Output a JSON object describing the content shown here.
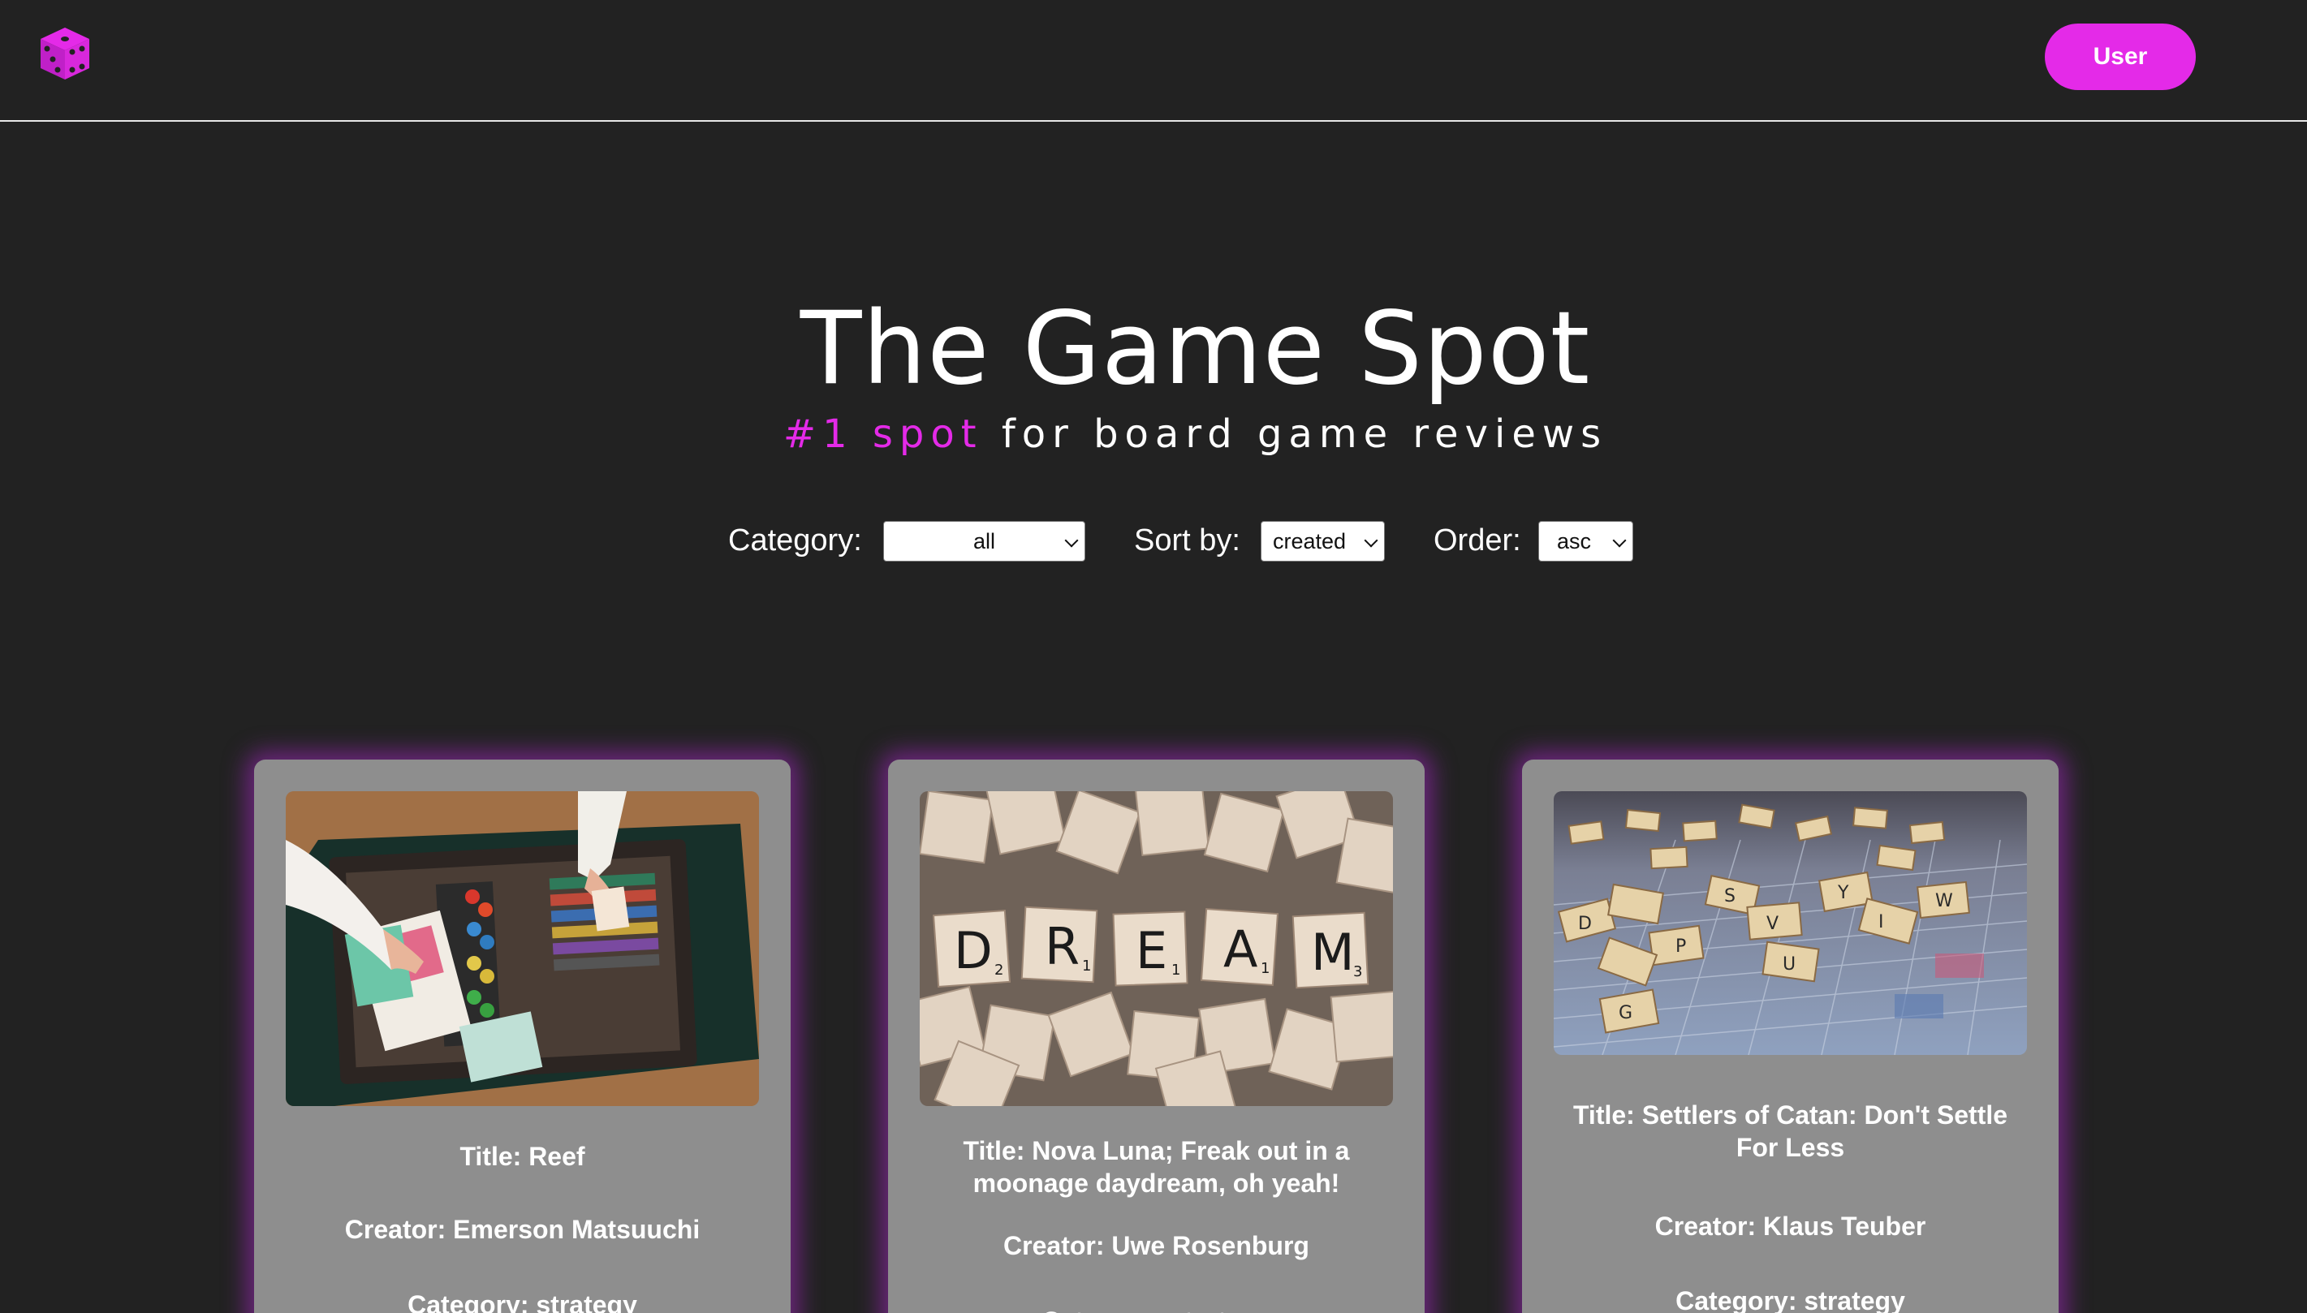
{
  "header": {
    "logo_icon": "dice-icon",
    "user_button_label": "User",
    "accent_color": "#e42ae8"
  },
  "hero": {
    "title": "The Game Spot",
    "subtitle_accent": "#1 spot",
    "subtitle_rest": " for board game reviews"
  },
  "filters": {
    "category_label": "Category:",
    "category_value": "all",
    "sort_label": "Sort by:",
    "sort_value": "created",
    "order_label": "Order:",
    "order_value": "asc"
  },
  "reviews": [
    {
      "title": "Title: Reef",
      "creator": "Creator: Emerson Matsuuchi",
      "category": "Category: strategy"
    },
    {
      "title": "Title: Nova Luna; Freak out in a moonage daydream, oh yeah!",
      "creator": "Creator: Uwe Rosenburg",
      "category": "Category: strategy"
    },
    {
      "title": "Title: Settlers of Catan: Don't Settle For Less",
      "creator": "Creator: Klaus Teuber",
      "category": "Category: strategy"
    }
  ]
}
